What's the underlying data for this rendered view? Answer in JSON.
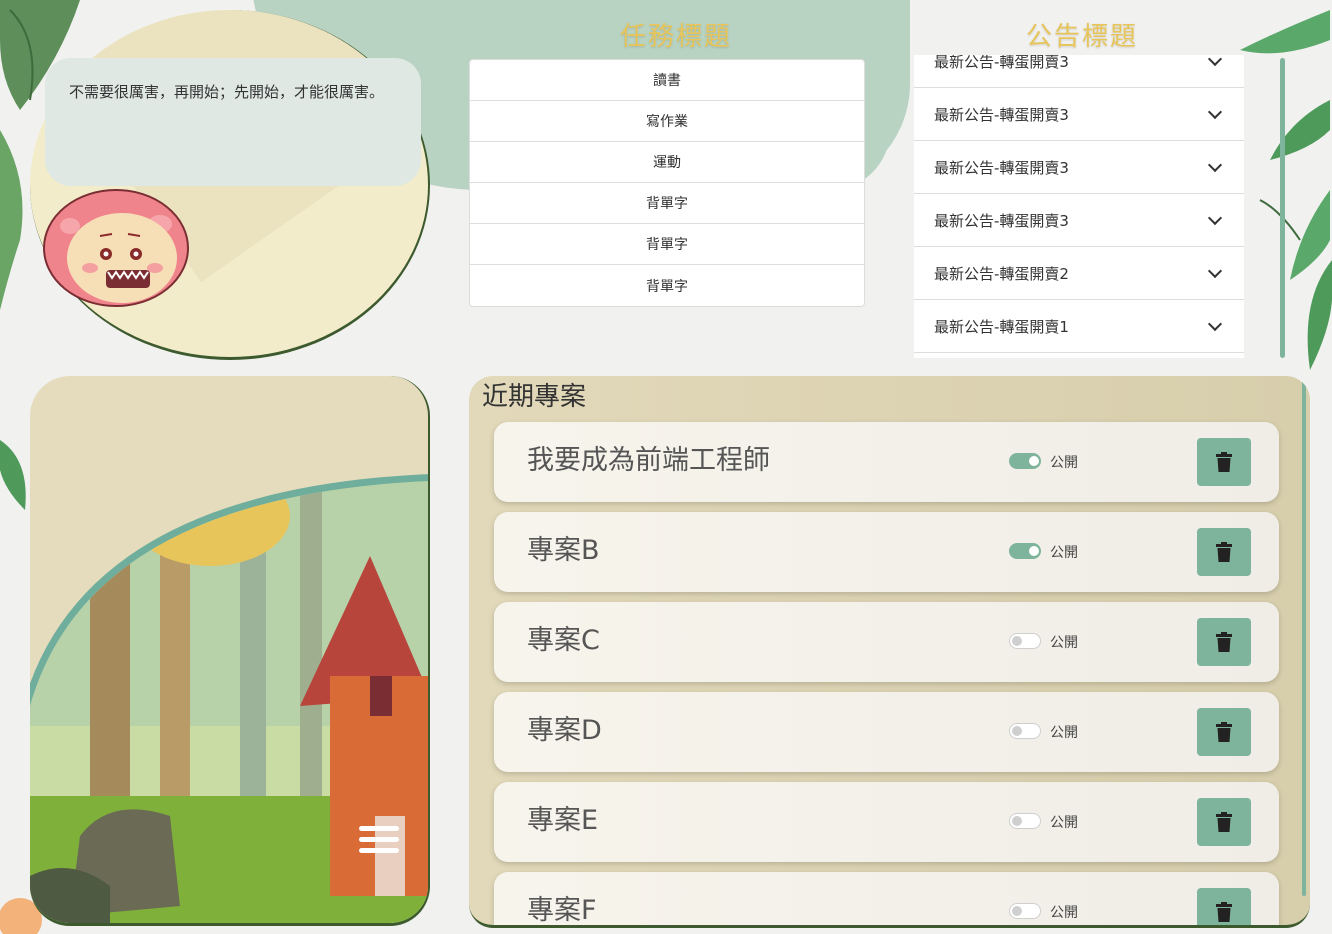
{
  "quote": {
    "text": "不需要很厲害，再開始；先開始，才能很厲害。"
  },
  "tasks": {
    "title": "任務標題",
    "items": [
      "讀書",
      "寫作業",
      "運動",
      "背單字",
      "背單字",
      "背單字"
    ]
  },
  "announcements": {
    "title": "公告標題",
    "items": [
      "最新公告-轉蛋開賣3",
      "最新公告-轉蛋開賣3",
      "最新公告-轉蛋開賣3",
      "最新公告-轉蛋開賣3",
      "最新公告-轉蛋開賣2",
      "最新公告-轉蛋開賣1"
    ]
  },
  "projects": {
    "title": "近期專案",
    "public_label": "公開",
    "items": [
      {
        "name": "我要成為前端工程師",
        "public": true
      },
      {
        "name": "專案B",
        "public": true
      },
      {
        "name": "專案C",
        "public": false
      },
      {
        "name": "專案D",
        "public": false
      },
      {
        "name": "專案E",
        "public": false
      },
      {
        "name": "專案F",
        "public": false
      }
    ]
  },
  "icons": {
    "chevron": "chevron-down-icon",
    "trash": "trash-icon",
    "menu": "hamburger-menu-icon"
  },
  "colors": {
    "accent": "#7fb49c",
    "title_gold": "#e7c55a",
    "panel_beige": "#e2d9ba",
    "bubble": "#e0e8e4"
  }
}
